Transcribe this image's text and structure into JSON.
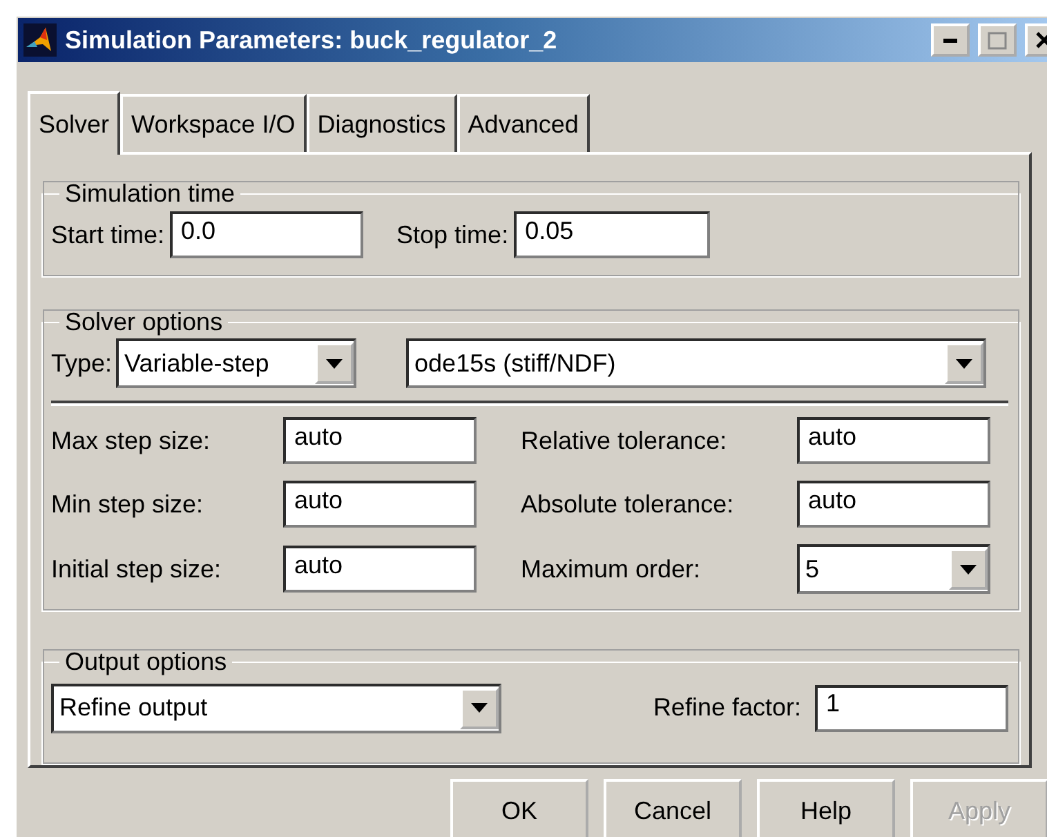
{
  "window": {
    "title": "Simulation Parameters: buck_regulator_2"
  },
  "tabs": [
    {
      "label": "Solver",
      "selected": true
    },
    {
      "label": "Workspace I/O",
      "selected": false
    },
    {
      "label": "Diagnostics",
      "selected": false
    },
    {
      "label": "Advanced",
      "selected": false
    }
  ],
  "simulation_time": {
    "title": "Simulation time",
    "start_label": "Start time:",
    "start_value": "0.0",
    "stop_label": "Stop time:",
    "stop_value": "0.05"
  },
  "solver_options": {
    "title": "Solver options",
    "type_label": "Type:",
    "type": "Variable-step",
    "solver": "ode15s (stiff/NDF)",
    "fields": [
      {
        "label": "Max step size:",
        "value": "auto",
        "kind": "text"
      },
      {
        "label": "Relative tolerance:",
        "value": "auto",
        "kind": "text"
      },
      {
        "label": "Min step size:",
        "value": "auto",
        "kind": "text"
      },
      {
        "label": "Absolute tolerance:",
        "value": "auto",
        "kind": "text"
      },
      {
        "label": "Initial step size:",
        "value": "auto",
        "kind": "text"
      },
      {
        "label": "Maximum order:",
        "value": "5",
        "kind": "dropdown"
      }
    ]
  },
  "output_options": {
    "title": "Output options",
    "mode": "Refine output",
    "factor_label": "Refine factor:",
    "factor": "1"
  },
  "buttons": [
    {
      "label": "OK",
      "disabled": false
    },
    {
      "label": "Cancel",
      "disabled": false
    },
    {
      "label": "Help",
      "disabled": false
    },
    {
      "label": "Apply",
      "disabled": true
    }
  ]
}
